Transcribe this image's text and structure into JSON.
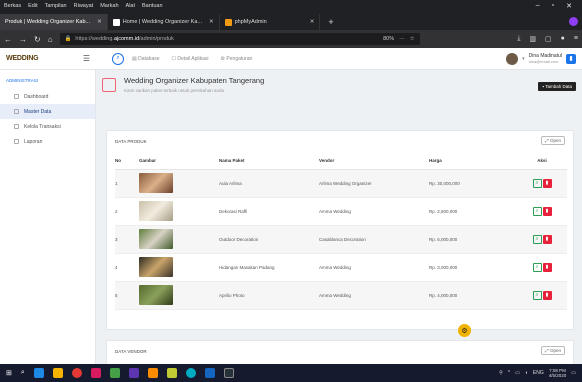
{
  "browser": {
    "menu": [
      "Berkas",
      "Edit",
      "Tampilan",
      "Riwayat",
      "Markah",
      "Alat",
      "Bantuan"
    ],
    "tabs": [
      {
        "title": "Produk | Wedding Organizer Kab...",
        "active": true
      },
      {
        "title": "Home | Wedding Organizer Ka...",
        "active": false
      },
      {
        "title": "phpMyAdmin",
        "active": false
      }
    ],
    "url_prefix": "https://wedding.",
    "url_domain": "ajcomm.id",
    "url_path": "/admin/produk",
    "zoom": "80%"
  },
  "app": {
    "brand": "WEDDING",
    "topnav": [
      "Database",
      "Detail Aplikasi",
      "Pengaturan"
    ],
    "user_name": "Dina Madinatul",
    "user_email": "dina@email.com"
  },
  "sidebar": {
    "section": "ADMINISTRASI",
    "items": [
      {
        "label": "Dashboard",
        "active": false
      },
      {
        "label": "Master Data",
        "active": true
      },
      {
        "label": "Kelola Transaksi",
        "active": false
      },
      {
        "label": "Laporan",
        "active": false
      }
    ]
  },
  "page": {
    "title": "Wedding Organizer Kabupaten Tangerang",
    "subtitle": "Kami sarikan paket terbaik untuk pernikahan anda",
    "add_button": "Tambah Data"
  },
  "produk": {
    "title": "DATA PRODUK",
    "open_button": "Open",
    "headers": [
      "No",
      "Gambar",
      "Nama Paket",
      "Vendor",
      "Harga",
      "Aksi"
    ],
    "rows": [
      {
        "no": "1",
        "nama": "Aula Arlima",
        "vendor": "Arlima Wedding Organizer",
        "harga": "Rp. 30,000,000"
      },
      {
        "no": "2",
        "nama": "Dekorasi Raffi",
        "vendor": "Amma Wedding",
        "harga": "Rp. 2,500,000"
      },
      {
        "no": "3",
        "nama": "Outdoor Decoration",
        "vendor": "Casablanca Decoration",
        "harga": "Rp. 5,000,000"
      },
      {
        "no": "4",
        "nama": "Hidangan Masakan Padang",
        "vendor": "Amma Wedding",
        "harga": "Rp. 3,000,000"
      },
      {
        "no": "5",
        "nama": "Aprilio Photo",
        "vendor": "Amma Wedding",
        "harga": "Rp. 4,000,000"
      }
    ]
  },
  "vendor": {
    "title": "DATA VENDOR",
    "open_button": "Open"
  },
  "taskbar": {
    "time": "7:08 PM",
    "date": "4/5/2020",
    "lang": "ENG"
  },
  "colors": {
    "accent": "#1a73e8",
    "delete": "#e8223b",
    "view": "#2c9e55",
    "fab": "#f1b300"
  }
}
